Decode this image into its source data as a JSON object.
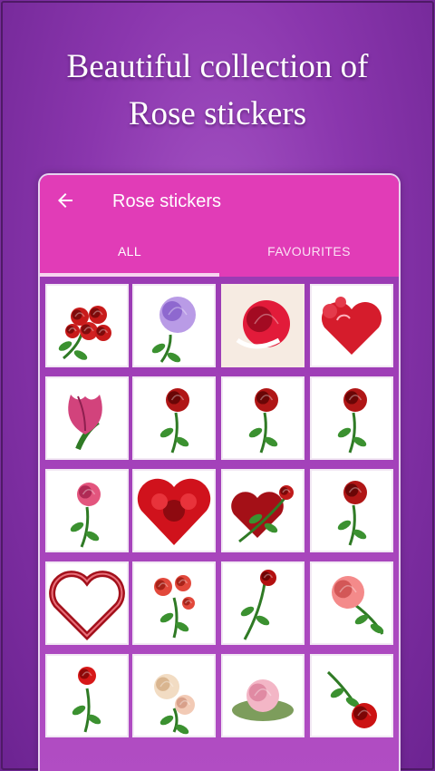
{
  "promo": {
    "line1": "Beautiful collection of",
    "line2": "Rose stickers"
  },
  "appbar": {
    "back_icon": "arrow-left-icon",
    "title": "Rose stickers"
  },
  "tabs": [
    {
      "label": "ALL",
      "selected": true
    },
    {
      "label": "FAVOURITES",
      "selected": false
    }
  ],
  "stickers": [
    "red-rose-bouquet",
    "purple-rose",
    "red-white-rose",
    "hearts-card",
    "pink-tulip",
    "single-red-rose",
    "single-red-rose",
    "single-red-rose",
    "pink-rose",
    "red-rose-heart",
    "rose-heart-with-stem",
    "single-red-rose",
    "heart-outline",
    "red-rose-bush",
    "long-stem-rose",
    "coral-rose",
    "red-rose-small",
    "cream-roses",
    "pink-rose-bowl",
    "red-rose-sprig"
  ],
  "colors": {
    "background": "#8a36ad",
    "appbar": "#e13cb7",
    "tab_indicator": "#f7d4ef",
    "grid_bg": "#a23fb8"
  }
}
